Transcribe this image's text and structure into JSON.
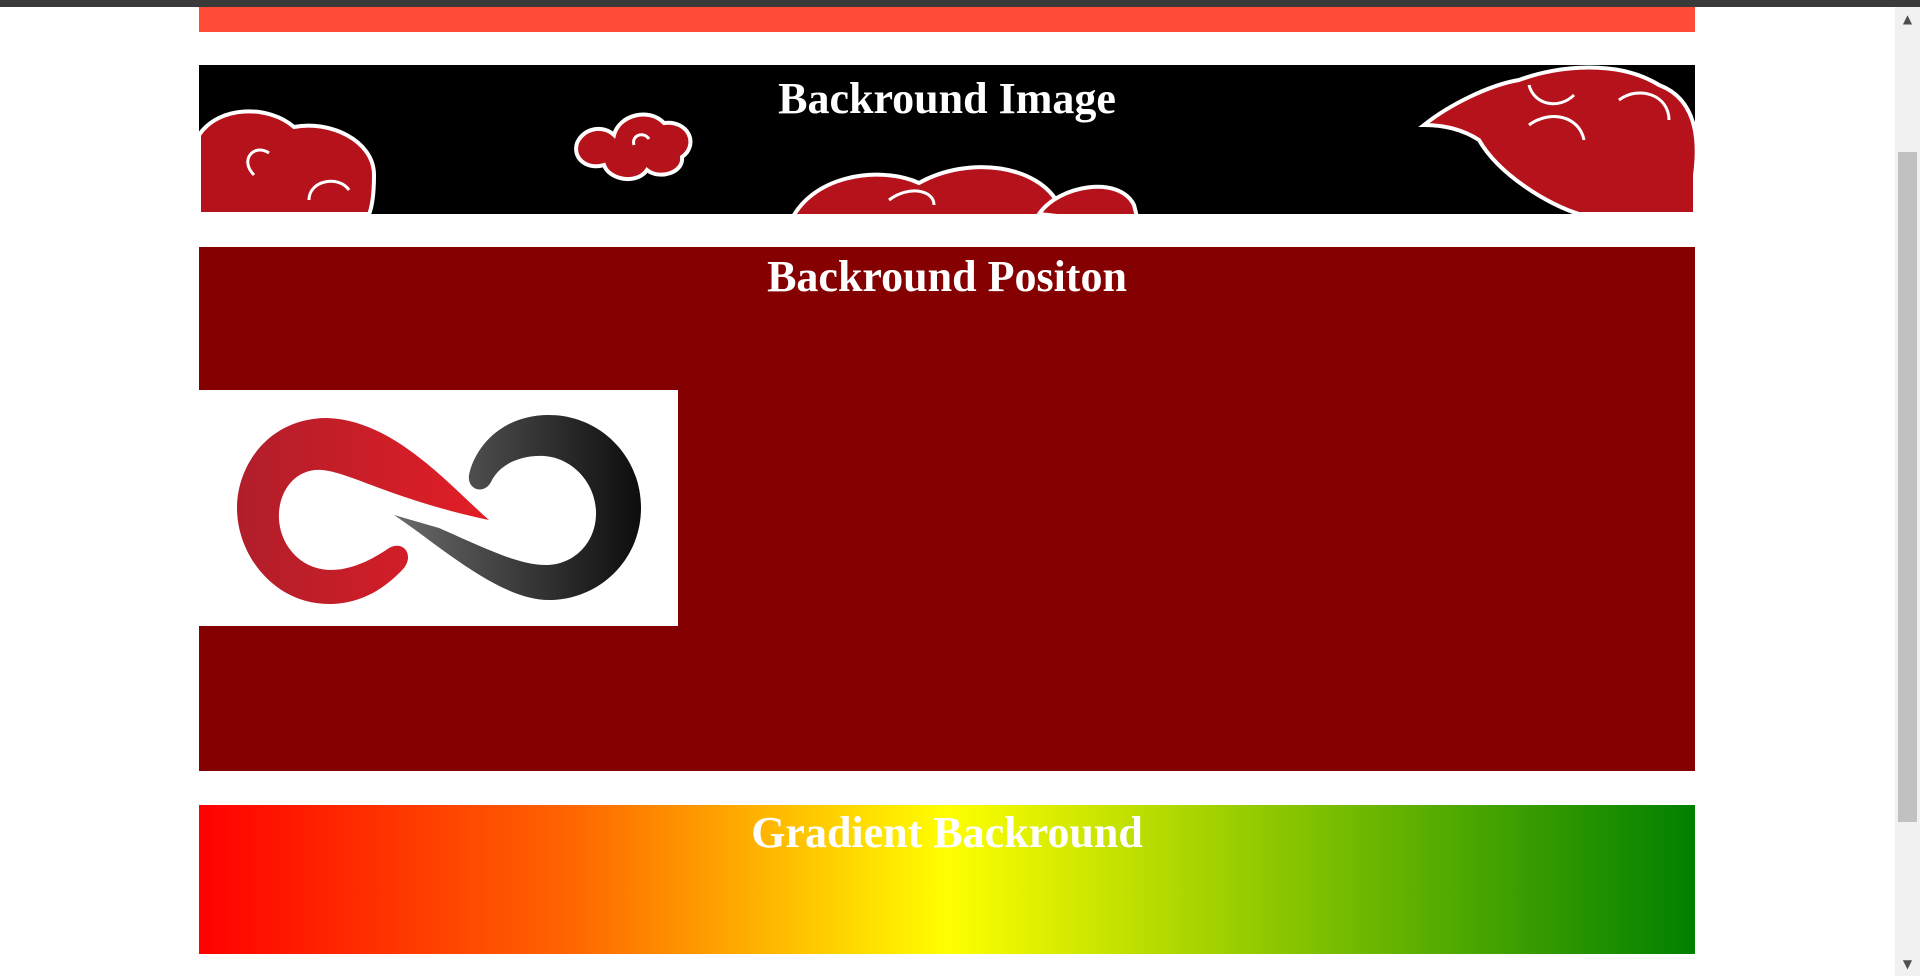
{
  "sections": {
    "background_image": {
      "title": "Backround Image"
    },
    "background_position": {
      "title": "Backround Positon"
    },
    "gradient": {
      "title": "Gradient Backround"
    }
  },
  "colors": {
    "strip": "#ff4b37",
    "image_bg": "#000000",
    "cloud": "#b5121b",
    "position_bg": "#850000",
    "gradient_stops": [
      "#ff0000",
      "#ff6600",
      "#ffff00",
      "#7dbf00",
      "#008000"
    ]
  },
  "icons": {
    "logo": "infinity-logo-icon",
    "clouds": "cloud-pattern-icon",
    "scroll_up": "chevron-up-icon",
    "scroll_down": "chevron-down-icon"
  }
}
